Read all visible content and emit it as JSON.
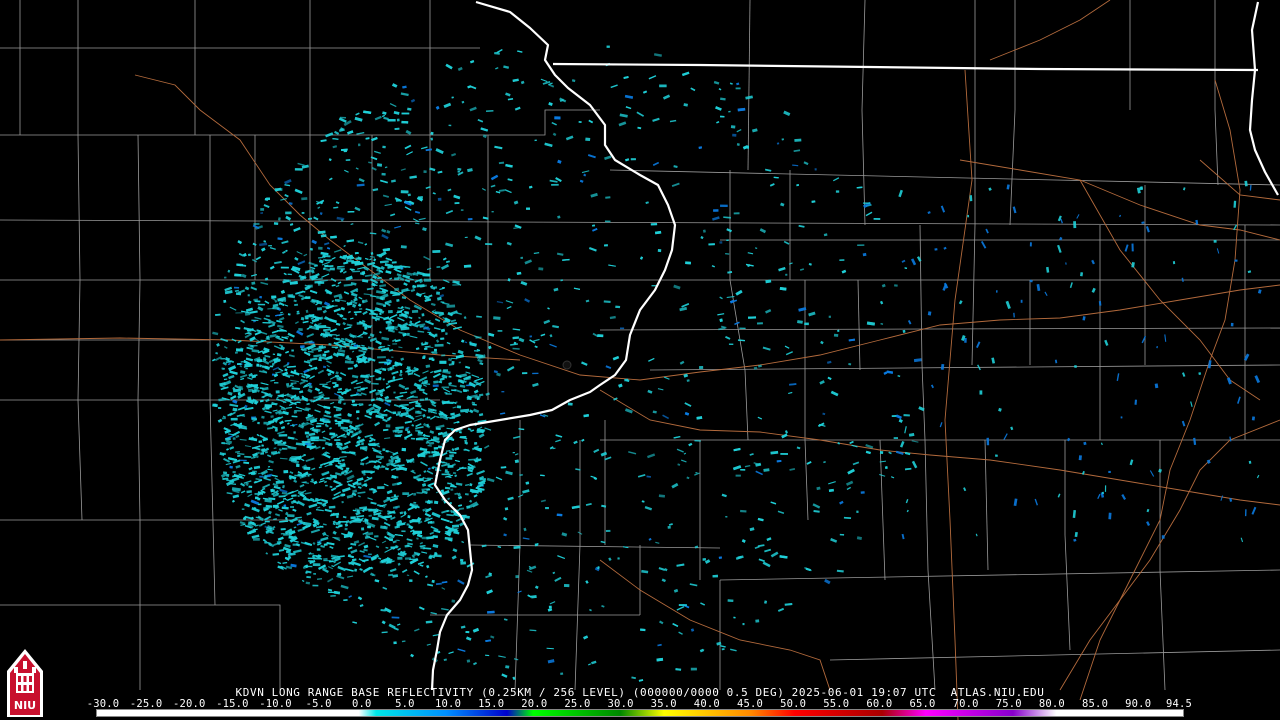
{
  "product": {
    "caption": "KDVN LONG RANGE BASE REFLECTIVITY (0.25KM / 256 LEVEL) (000000/0000 0.5 DEG) 2025-06-01 19:07 UTC  ATLAS.NIU.EDU"
  },
  "color_scale": {
    "labels": [
      "-30.0",
      "-25.0",
      "-20.0",
      "-15.0",
      "-10.0",
      "-5.0",
      "0.0",
      "5.0",
      "10.0",
      "15.0",
      "20.0",
      "25.0",
      "30.0",
      "35.0",
      "40.0",
      "45.0",
      "50.0",
      "55.0",
      "60.0",
      "65.0",
      "70.0",
      "75.0",
      "80.0",
      "85.0",
      "90.0",
      "94.5"
    ],
    "values": [
      -30,
      -25,
      -20,
      -15,
      -10,
      -5,
      0,
      5,
      10,
      15,
      20,
      25,
      30,
      35,
      40,
      45,
      50,
      55,
      60,
      65,
      70,
      75,
      80,
      85,
      90,
      94.5
    ],
    "stops": [
      {
        "dbz": -30,
        "color": "#ffffff"
      },
      {
        "dbz": 0,
        "color": "#ffffff"
      },
      {
        "dbz": 2,
        "color": "#00e6e6"
      },
      {
        "dbz": 10,
        "color": "#0090ff"
      },
      {
        "dbz": 17,
        "color": "#0000cc"
      },
      {
        "dbz": 20,
        "color": "#00ff00"
      },
      {
        "dbz": 30,
        "color": "#008800"
      },
      {
        "dbz": 35,
        "color": "#ffff00"
      },
      {
        "dbz": 45,
        "color": "#ff8800"
      },
      {
        "dbz": 50,
        "color": "#ff0000"
      },
      {
        "dbz": 60,
        "color": "#aa0000"
      },
      {
        "dbz": 65,
        "color": "#ff00ff"
      },
      {
        "dbz": 75,
        "color": "#8800cc"
      },
      {
        "dbz": 80,
        "color": "#ffffff"
      },
      {
        "dbz": 94.5,
        "color": "#ffffff"
      }
    ]
  },
  "logo": {
    "text": "NIU",
    "color": "#c8102e"
  },
  "map_colors": {
    "state_border": "#ffffff",
    "county_line": "#9a9a9a",
    "highway": "#b36a3c",
    "echo_main": "#1fd0d8",
    "echo_secondary": "#0a7ae0",
    "radar_site": "#111111"
  }
}
